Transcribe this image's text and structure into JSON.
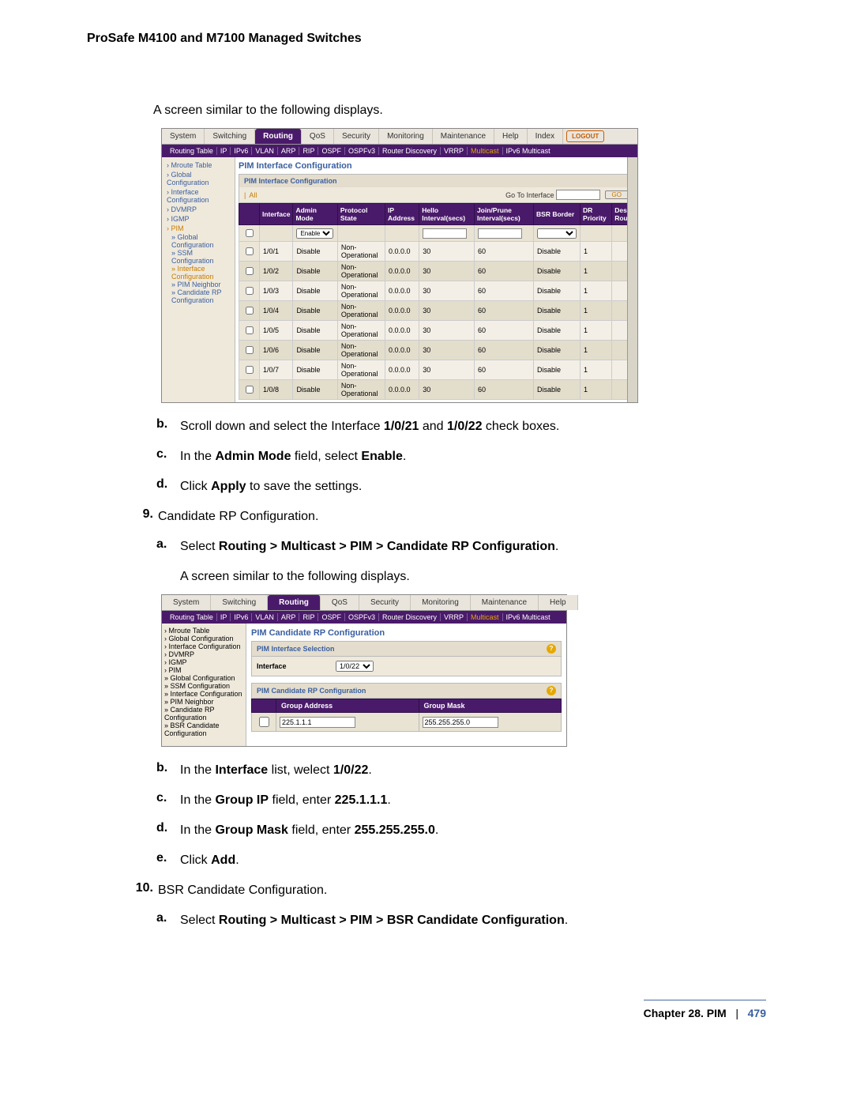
{
  "header": "ProSafe M4100 and M7100 Managed Switches",
  "intro1": "A screen similar to the following displays.",
  "step_b": "Scroll down and select the Interface ",
  "step_b_bold1": "1/0/21",
  "step_b_mid": " and ",
  "step_b_bold2": "1/0/22",
  "step_b_end": " check boxes.",
  "step_c_pre": "In the ",
  "step_c_bold1": "Admin Mode",
  "step_c_mid": " field, select ",
  "step_c_bold2": "Enable",
  "step_d_pre": "Click ",
  "step_d_bold": "Apply",
  "step_d_end": " to save the settings.",
  "step9": "Candidate RP Configuration.",
  "step9a_pre": "Select ",
  "step9a_bold": "Routing > Multicast > PIM > Candidate RP Configuration",
  "intro2": "A screen similar to the following displays.",
  "post_b_pre": "In the ",
  "post_b_bold": "Interface",
  "post_b_mid": " list, welect ",
  "post_b_bold2": "1/0/22",
  "post_c_pre": "In the ",
  "post_c_bold": "Group IP",
  "post_c_mid": " field, enter ",
  "post_c_bold2": "225.1.1.1",
  "post_d_pre": "In the ",
  "post_d_bold": "Group Mask",
  "post_d_mid": " field, enter ",
  "post_d_bold2": "255.255.255.0",
  "post_e_pre": "Click ",
  "post_e_bold": "Add",
  "step10": "BSR Candidate Configuration.",
  "step10a_pre": "Select ",
  "step10a_bold": "Routing > Multicast > PIM > BSR Candidate Configuration",
  "footer_chapter": "Chapter 28.  PIM",
  "footer_sep": "|",
  "footer_page": "479",
  "shot1": {
    "logout": "LOGOUT",
    "tabs": [
      "System",
      "Switching",
      "Routing",
      "QoS",
      "Security",
      "Monitoring",
      "Maintenance",
      "Help",
      "Index"
    ],
    "active_tab": 2,
    "subtabs": [
      "Routing Table",
      "IP",
      "IPv6",
      "VLAN",
      "ARP",
      "RIP",
      "OSPF",
      "OSPFv3",
      "Router Discovery",
      "VRRP",
      "Multicast",
      "IPv6 Multicast"
    ],
    "subtab_hl": 10,
    "sidebar": [
      "Mroute Table",
      "Global Configuration",
      "Interface Configuration",
      "DVMRP",
      "IGMP",
      "PIM"
    ],
    "pim_children": [
      "Global Configuration",
      "SSM Configuration",
      "Interface Configuration",
      "PIM Neighbor",
      "Candidate RP Configuration"
    ],
    "pim_sel": 2,
    "title": "PIM Interface Configuration",
    "inner_title": "PIM Interface Configuration",
    "filter_all": "All",
    "filter_goto": "Go To Interface",
    "go": "GO",
    "cols": [
      "",
      "Interface",
      "Admin Mode",
      "Protocol State",
      "IP Address",
      "Hello Interval(secs)",
      "Join/Prune Interval(secs)",
      "BSR Border",
      "DR Priority",
      "Des Rou"
    ],
    "enable_opt": "Enable",
    "rows": [
      {
        "if": "1/0/1",
        "am": "Disable",
        "ps": "Non-Operational",
        "ip": "0.0.0.0",
        "hi": "30",
        "jp": "60",
        "bsr": "Disable",
        "dr": "1"
      },
      {
        "if": "1/0/2",
        "am": "Disable",
        "ps": "Non-Operational",
        "ip": "0.0.0.0",
        "hi": "30",
        "jp": "60",
        "bsr": "Disable",
        "dr": "1"
      },
      {
        "if": "1/0/3",
        "am": "Disable",
        "ps": "Non-Operational",
        "ip": "0.0.0.0",
        "hi": "30",
        "jp": "60",
        "bsr": "Disable",
        "dr": "1"
      },
      {
        "if": "1/0/4",
        "am": "Disable",
        "ps": "Non-Operational",
        "ip": "0.0.0.0",
        "hi": "30",
        "jp": "60",
        "bsr": "Disable",
        "dr": "1"
      },
      {
        "if": "1/0/5",
        "am": "Disable",
        "ps": "Non-Operational",
        "ip": "0.0.0.0",
        "hi": "30",
        "jp": "60",
        "bsr": "Disable",
        "dr": "1"
      },
      {
        "if": "1/0/6",
        "am": "Disable",
        "ps": "Non-Operational",
        "ip": "0.0.0.0",
        "hi": "30",
        "jp": "60",
        "bsr": "Disable",
        "dr": "1"
      },
      {
        "if": "1/0/7",
        "am": "Disable",
        "ps": "Non-Operational",
        "ip": "0.0.0.0",
        "hi": "30",
        "jp": "60",
        "bsr": "Disable",
        "dr": "1"
      },
      {
        "if": "1/0/8",
        "am": "Disable",
        "ps": "Non-Operational",
        "ip": "0.0.0.0",
        "hi": "30",
        "jp": "60",
        "bsr": "Disable",
        "dr": "1"
      }
    ]
  },
  "shot2": {
    "tabs": [
      "System",
      "Switching",
      "Routing",
      "QoS",
      "Security",
      "Monitoring",
      "Maintenance",
      "Help"
    ],
    "active_tab": 2,
    "subtabs": [
      "Routing Table",
      "IP",
      "IPv6",
      "VLAN",
      "ARP",
      "RIP",
      "OSPF",
      "OSPFv3",
      "Router Discovery",
      "VRRP",
      "Multicast",
      "IPv6 Multicast"
    ],
    "subtab_hl": 10,
    "sidebar": [
      "Mroute Table",
      "Global Configuration",
      "Interface Configuration",
      "DVMRP",
      "IGMP",
      "PIM"
    ],
    "pim_children": [
      "Global Configuration",
      "SSM Configuration",
      "Interface Configuration",
      "PIM Neighbor",
      "Candidate RP Configuration",
      "BSR Candidate Configuration"
    ],
    "pim_sel": 4,
    "title": "PIM Candidate RP Configuration",
    "panel1_title": "PIM Interface Selection",
    "panel1_label": "Interface",
    "panel1_value": "1/0/22",
    "panel2_title": "PIM Candidate RP Configuration",
    "cols": [
      "",
      "Group Address",
      "Group Mask"
    ],
    "group_addr": "225.1.1.1",
    "group_mask": "255.255.255.0"
  }
}
